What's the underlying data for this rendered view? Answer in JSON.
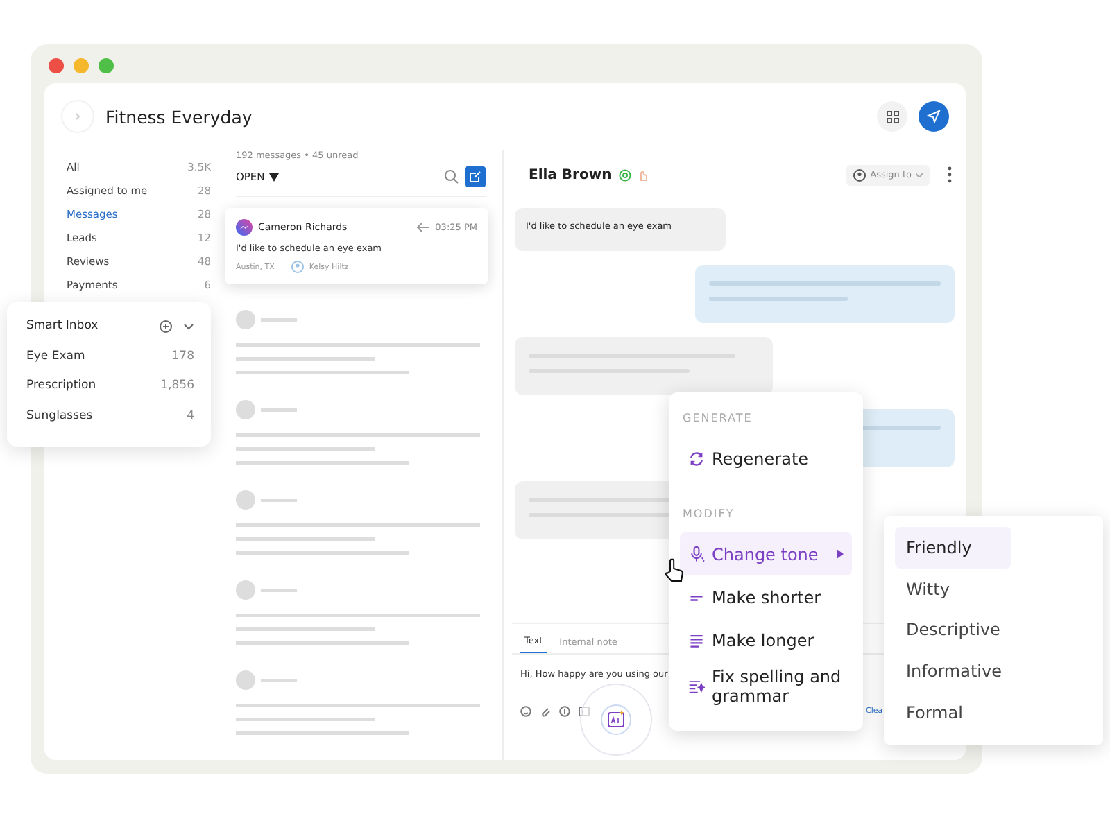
{
  "window": {
    "title": "Fitness Everyday"
  },
  "sidebar": {
    "items": [
      {
        "label": "All",
        "count": "3.5K",
        "selected": false
      },
      {
        "label": "Assigned to me",
        "count": "28",
        "selected": false
      },
      {
        "label": "Messages",
        "count": "28",
        "selected": true
      },
      {
        "label": "Leads",
        "count": "12",
        "selected": false
      },
      {
        "label": "Reviews",
        "count": "48",
        "selected": false
      },
      {
        "label": "Payments",
        "count": "6",
        "selected": false
      }
    ]
  },
  "smart_inbox": {
    "title": "Smart Inbox",
    "items": [
      {
        "label": "Eye Exam",
        "count": "178"
      },
      {
        "label": "Prescription",
        "count": "1,856"
      },
      {
        "label": "Sunglasses",
        "count": "4"
      }
    ]
  },
  "message_list": {
    "summary": "192 messages • 45 unread",
    "filter": "OPEN",
    "conversations": [
      {
        "name": "Cameron Richards",
        "time": "03:25 PM",
        "preview": "I'd like to schedule an eye exam",
        "location": "Austin, TX",
        "assignee": "Kelsy Hiltz"
      }
    ]
  },
  "chat": {
    "contact": "Ella Brown",
    "assign": "Assign to",
    "messages": [
      {
        "kind": "incoming",
        "text": "I'd like to schedule an eye exam"
      },
      {
        "kind": "outgoing"
      },
      {
        "kind": "incoming"
      },
      {
        "kind": "outgoing"
      },
      {
        "kind": "incoming"
      }
    ]
  },
  "composer": {
    "tabs": [
      {
        "label": "Text",
        "selected": true
      },
      {
        "label": "Internal note",
        "selected": false
      }
    ],
    "value": "Hi, How happy are you using our",
    "link": "Clea"
  },
  "ai_menu": {
    "sections": [
      {
        "title": "GENERATE",
        "items": [
          {
            "kind": "regenerate",
            "label": "Regenerate",
            "selected": false,
            "submenu": false
          }
        ]
      },
      {
        "title": "MODIFY",
        "items": [
          {
            "kind": "tone",
            "label": "Change tone",
            "selected": true,
            "submenu": true
          },
          {
            "kind": "shorter",
            "label": "Make shorter",
            "selected": false,
            "submenu": false
          },
          {
            "kind": "longer",
            "label": "Make longer",
            "selected": false,
            "submenu": false
          },
          {
            "kind": "fix",
            "label": "Fix spelling and grammar",
            "selected": false,
            "submenu": false
          }
        ]
      }
    ]
  },
  "tone_menu": {
    "items": [
      {
        "label": "Friendly",
        "selected": true
      },
      {
        "label": "Witty",
        "selected": false
      },
      {
        "label": "Descriptive",
        "selected": false
      },
      {
        "label": "Informative",
        "selected": false
      },
      {
        "label": "Formal",
        "selected": false
      }
    ]
  }
}
